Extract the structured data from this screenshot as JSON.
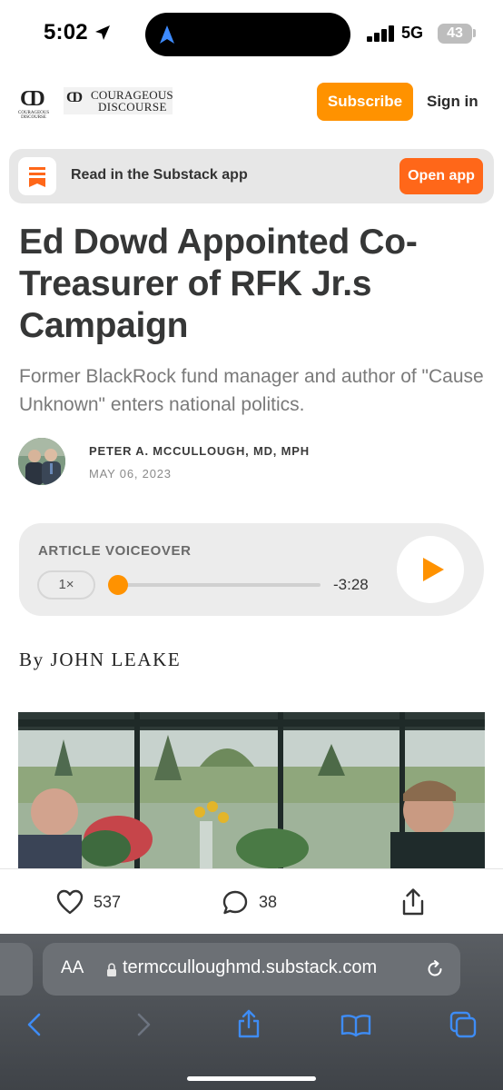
{
  "status_bar": {
    "time": "5:02",
    "network": "5G",
    "battery": "43"
  },
  "header": {
    "logo_small_text": "COURAGEOUS DISCOURSE",
    "logo_word_line1": "COURAGEOUS",
    "logo_word_line2": "DISCOURSE",
    "subscribe_label": "Subscribe",
    "signin_label": "Sign in",
    "accent_color": "#ff9200"
  },
  "app_banner": {
    "text": "Read in the Substack app",
    "button_label": "Open app",
    "button_color": "#ff6719"
  },
  "article": {
    "title": "Ed Dowd Appointed Co-Treasurer of RFK Jr.s Campaign",
    "subtitle": "Former BlackRock fund manager and author of \"Cause Unknown\" enters national politics.",
    "author": "PETER A. MCCULLOUGH, MD, MPH",
    "date": "MAY 06, 2023",
    "byline": "By JOHN LEAKE"
  },
  "voiceover": {
    "label": "ARTICLE VOICEOVER",
    "speed": "1×",
    "time_remaining": "-3:28",
    "progress": 0.02
  },
  "engagement": {
    "likes": "537",
    "comments": "38"
  },
  "browser": {
    "aa_label": "AA",
    "url": "termcculloughmd.substack.com"
  }
}
